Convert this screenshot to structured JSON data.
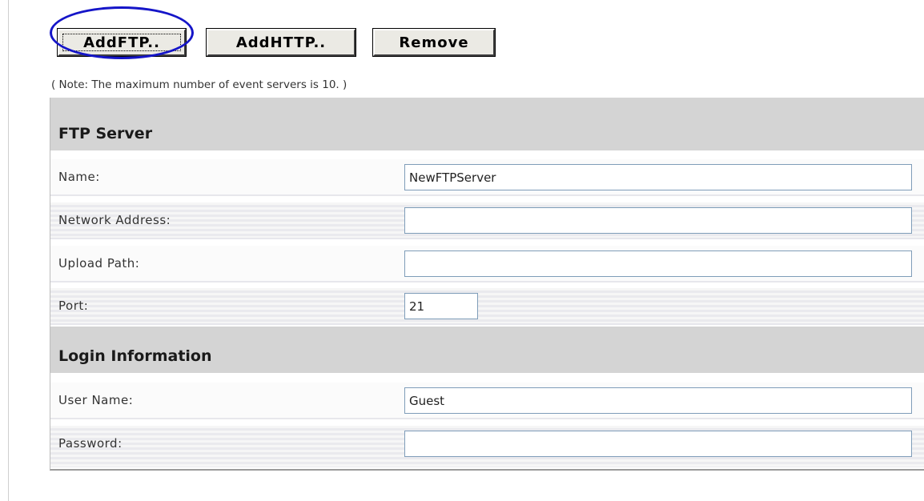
{
  "toolbar": {
    "add_ftp_label": "AddFTP..",
    "add_http_label": "AddHTTP..",
    "remove_label": "Remove"
  },
  "note": "( Note: The maximum number of event servers is 10. )",
  "ftp_server": {
    "title": "FTP Server",
    "name": {
      "label": "Name:",
      "value": "NewFTPServer"
    },
    "network_address": {
      "label": "Network Address:",
      "value": ""
    },
    "upload_path": {
      "label": "Upload Path:",
      "value": ""
    },
    "port": {
      "label": "Port:",
      "value": "21"
    }
  },
  "login_information": {
    "title": "Login Information",
    "user_name": {
      "label": "User Name:",
      "value": "Guest"
    },
    "password": {
      "label": "Password:",
      "value": ""
    }
  },
  "colors": {
    "highlight_ellipse": "#1515c8",
    "section_header_bg": "#d4d4d4",
    "field_border": "#7f9db9"
  }
}
